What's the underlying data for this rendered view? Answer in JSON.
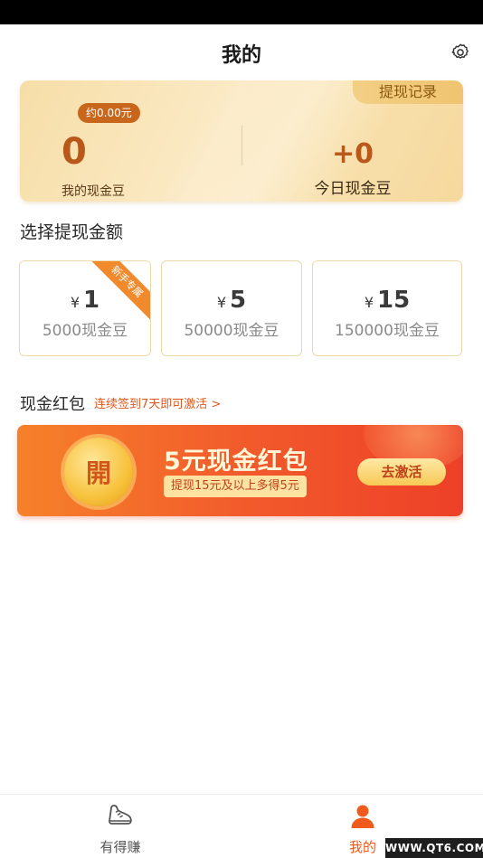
{
  "header": {
    "title": "我的"
  },
  "balance": {
    "record_label": "提现记录",
    "approx": "约0.00元",
    "beans": "0",
    "beans_label": "我的现金豆",
    "today": "+0",
    "today_label": "今日现金豆"
  },
  "withdraw": {
    "title": "选择提现金额",
    "options": [
      {
        "yen": "¥",
        "amount": "1",
        "beans": "5000现金豆",
        "tag": "新手专属"
      },
      {
        "yen": "¥",
        "amount": "5",
        "beans": "50000现金豆"
      },
      {
        "yen": "¥",
        "amount": "15",
        "beans": "150000现金豆"
      }
    ]
  },
  "redpack": {
    "title": "现金红包",
    "link": "连续签到7天即可激活 >",
    "coin_char": "開",
    "heading": "5元现金红包",
    "sub": "提现15元及以上多得5元",
    "button": "去激活"
  },
  "tabs": [
    {
      "label": "有得赚",
      "icon": "shoe-icon"
    },
    {
      "label": "我的",
      "icon": "person-icon",
      "active": true
    }
  ],
  "watermark": "WWW.QT6.COM",
  "colors": {
    "accent": "#f05a1c",
    "gold": "#f6dea7",
    "brown": "#b8581a"
  }
}
